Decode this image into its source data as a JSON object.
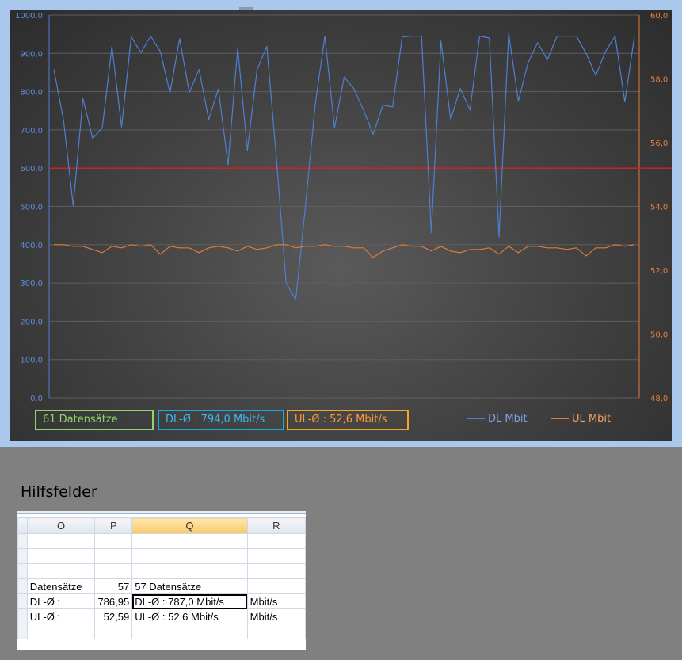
{
  "colors": {
    "dl_line": "#4f7fd0",
    "ul_line": "#e07a3a",
    "ref_line": "#d42020",
    "left_axis_text": "#5b8ed6",
    "right_axis_text": "#e8803a"
  },
  "chart_data": {
    "type": "line",
    "x_count": 61,
    "series": [
      {
        "name": "DL Mbit",
        "axis": "left",
        "values": [
          858,
          725,
          502,
          782,
          678,
          705,
          918,
          708,
          943,
          902,
          945,
          905,
          797,
          938,
          797,
          858,
          727,
          807,
          609,
          915,
          646,
          858,
          918,
          625,
          300,
          257,
          500,
          765,
          945,
          705,
          838,
          808,
          752,
          688,
          765,
          760,
          943,
          945,
          945,
          432,
          932,
          727,
          808,
          752,
          945,
          940,
          420,
          952,
          775,
          875,
          928,
          883,
          945,
          945,
          945,
          900,
          842,
          905,
          945,
          773,
          945
        ]
      },
      {
        "name": "UL Mbit",
        "axis": "right",
        "values": [
          52.8,
          52.8,
          52.75,
          52.75,
          52.65,
          52.55,
          52.75,
          52.7,
          52.8,
          52.75,
          52.8,
          52.5,
          52.75,
          52.7,
          52.7,
          52.55,
          52.7,
          52.75,
          52.7,
          52.6,
          52.75,
          52.65,
          52.7,
          52.8,
          52.8,
          52.7,
          52.75,
          52.75,
          52.8,
          52.75,
          52.75,
          52.7,
          52.7,
          52.4,
          52.6,
          52.7,
          52.8,
          52.75,
          52.75,
          52.6,
          52.75,
          52.6,
          52.55,
          52.65,
          52.65,
          52.7,
          52.5,
          52.75,
          52.55,
          52.75,
          52.75,
          52.7,
          52.7,
          52.65,
          52.7,
          52.45,
          52.7,
          52.7,
          52.8,
          52.75,
          52.8
        ]
      }
    ],
    "reference_line": {
      "axis": "left",
      "value": 600
    },
    "left_axis": {
      "ylim": [
        0,
        1000
      ],
      "ticks": [
        "0,0",
        "100,0",
        "200,0",
        "300,0",
        "400,0",
        "500,0",
        "600,0",
        "700,0",
        "800,0",
        "900,0",
        "1000,0"
      ]
    },
    "right_axis": {
      "ylim": [
        48,
        60
      ],
      "ticks": [
        "48,0",
        "50,0",
        "52,0",
        "54,0",
        "56,0",
        "58,0",
        "60,0"
      ]
    },
    "grid": true,
    "legend_position": "bottom-right",
    "legend": [
      "DL Mbit",
      "UL Mbit"
    ],
    "stat_boxes": [
      "61 Datensätze",
      "DL-Ø :  794,0 Mbit/s",
      "UL-Ø :  52,6 Mbit/s"
    ]
  },
  "hilfsfelder": {
    "title": "Hilfsfelder",
    "columns": [
      "O",
      "P",
      "Q",
      "R"
    ],
    "rows": [
      {
        "o": "",
        "p": "",
        "q": "",
        "r": ""
      },
      {
        "o": "",
        "p": "",
        "q": "",
        "r": ""
      },
      {
        "o": "",
        "p": "",
        "q": "",
        "r": ""
      },
      {
        "o": "Datensätze",
        "p": "57",
        "q": "57 Datensätze",
        "r": ""
      },
      {
        "o": "DL-Ø :",
        "p": "786,95",
        "q": "DL-Ø :  787,0 Mbit/s",
        "r": "Mbit/s"
      },
      {
        "o": "UL-Ø :",
        "p": "52,59",
        "q": "UL-Ø :  52,6 Mbit/s",
        "r": "Mbit/s"
      },
      {
        "o": "",
        "p": "",
        "q": "",
        "r": ""
      }
    ]
  }
}
